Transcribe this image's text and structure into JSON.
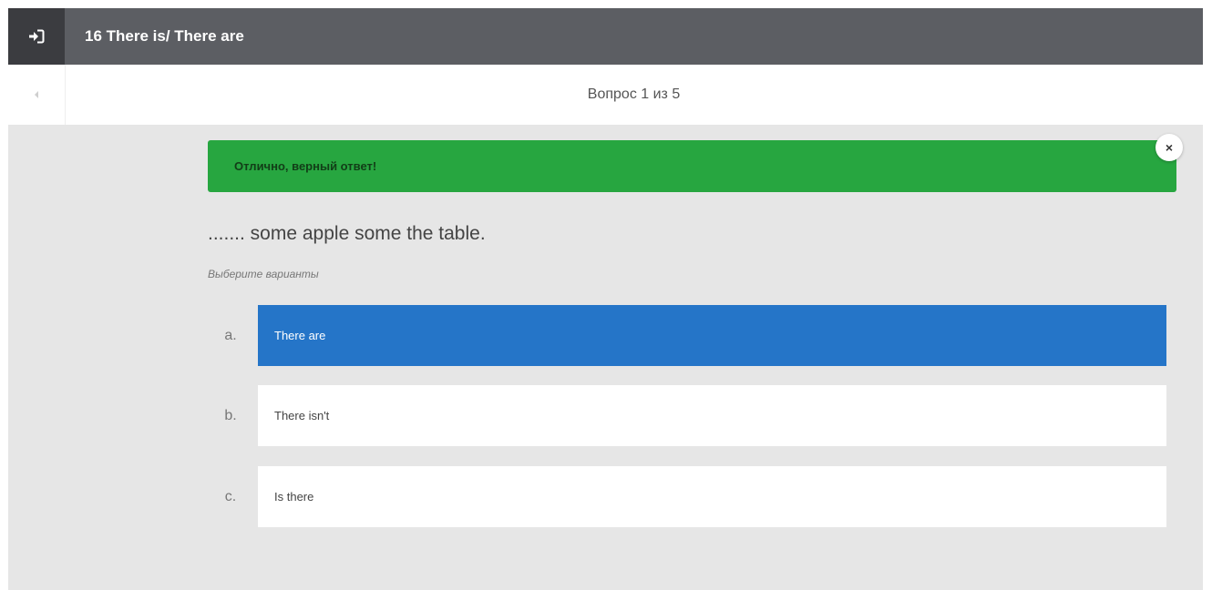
{
  "header": {
    "exit_icon": "exit-icon",
    "title": "16 There is/ There are"
  },
  "nav": {
    "back_icon": "chevron-left-icon",
    "progress": "Вопрос 1 из 5"
  },
  "alert": {
    "message": "Отлично, верный ответ!",
    "status": "success",
    "color": "#27a640",
    "close_icon": "close-icon",
    "close_glyph": "×"
  },
  "question": {
    "text": "....... some apple some the table.",
    "hint": "Выберите варианты"
  },
  "options": [
    {
      "letter": "a.",
      "label": "There are",
      "selected": true
    },
    {
      "letter": "b.",
      "label": "There isn't",
      "selected": false
    },
    {
      "letter": "c.",
      "label": "Is there",
      "selected": false
    }
  ],
  "colors": {
    "header_bg": "#5c5e63",
    "accent": "#2575c8",
    "page_bg": "#e6e6e6"
  }
}
